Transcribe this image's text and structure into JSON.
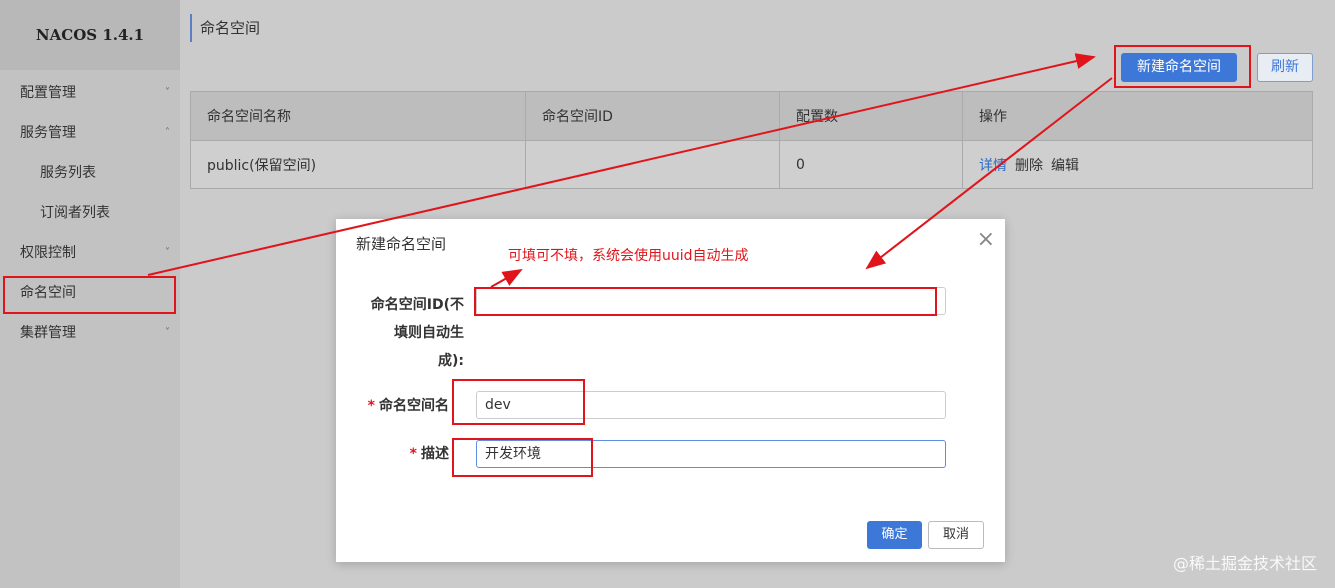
{
  "app": {
    "brand": "NACOS 1.4.1"
  },
  "sidebar": {
    "items": [
      {
        "label": "配置管理",
        "chevron": "˅"
      },
      {
        "label": "服务管理",
        "chevron": "˄"
      },
      {
        "label": "服务列表"
      },
      {
        "label": "订阅者列表"
      },
      {
        "label": "权限控制",
        "chevron": "˅"
      },
      {
        "label": "命名空间"
      },
      {
        "label": "集群管理",
        "chevron": "˅"
      }
    ]
  },
  "page": {
    "title": "命名空间"
  },
  "toolbar": {
    "new_label": "新建命名空间",
    "refresh_label": "刷新"
  },
  "table": {
    "headers": [
      "命名空间名称",
      "命名空间ID",
      "配置数",
      "操作"
    ],
    "rows": [
      {
        "name": "public(保留空间)",
        "id": "",
        "count": "0",
        "ops": {
          "detail": "详情",
          "delete": "删除",
          "edit": "编辑"
        }
      }
    ]
  },
  "dialog": {
    "title": "新建命名空间",
    "close": "×",
    "annotation": "可填可不填，系统会使用uuid自动生成",
    "fields": {
      "id": {
        "label_line1": "命名空间ID(不",
        "label_line2": "填则自动生",
        "label_line3": "成):",
        "value": ""
      },
      "name": {
        "required": "*",
        "label": "命名空间名",
        "value": "dev"
      },
      "desc": {
        "required": "*",
        "label": "描述",
        "value": "开发环境"
      }
    },
    "ok_label": "确定",
    "cancel_label": "取消"
  },
  "watermark": "@稀土掘金技术社区",
  "colors": {
    "primary": "#3d78d8",
    "annotation_red": "#e0151c"
  }
}
